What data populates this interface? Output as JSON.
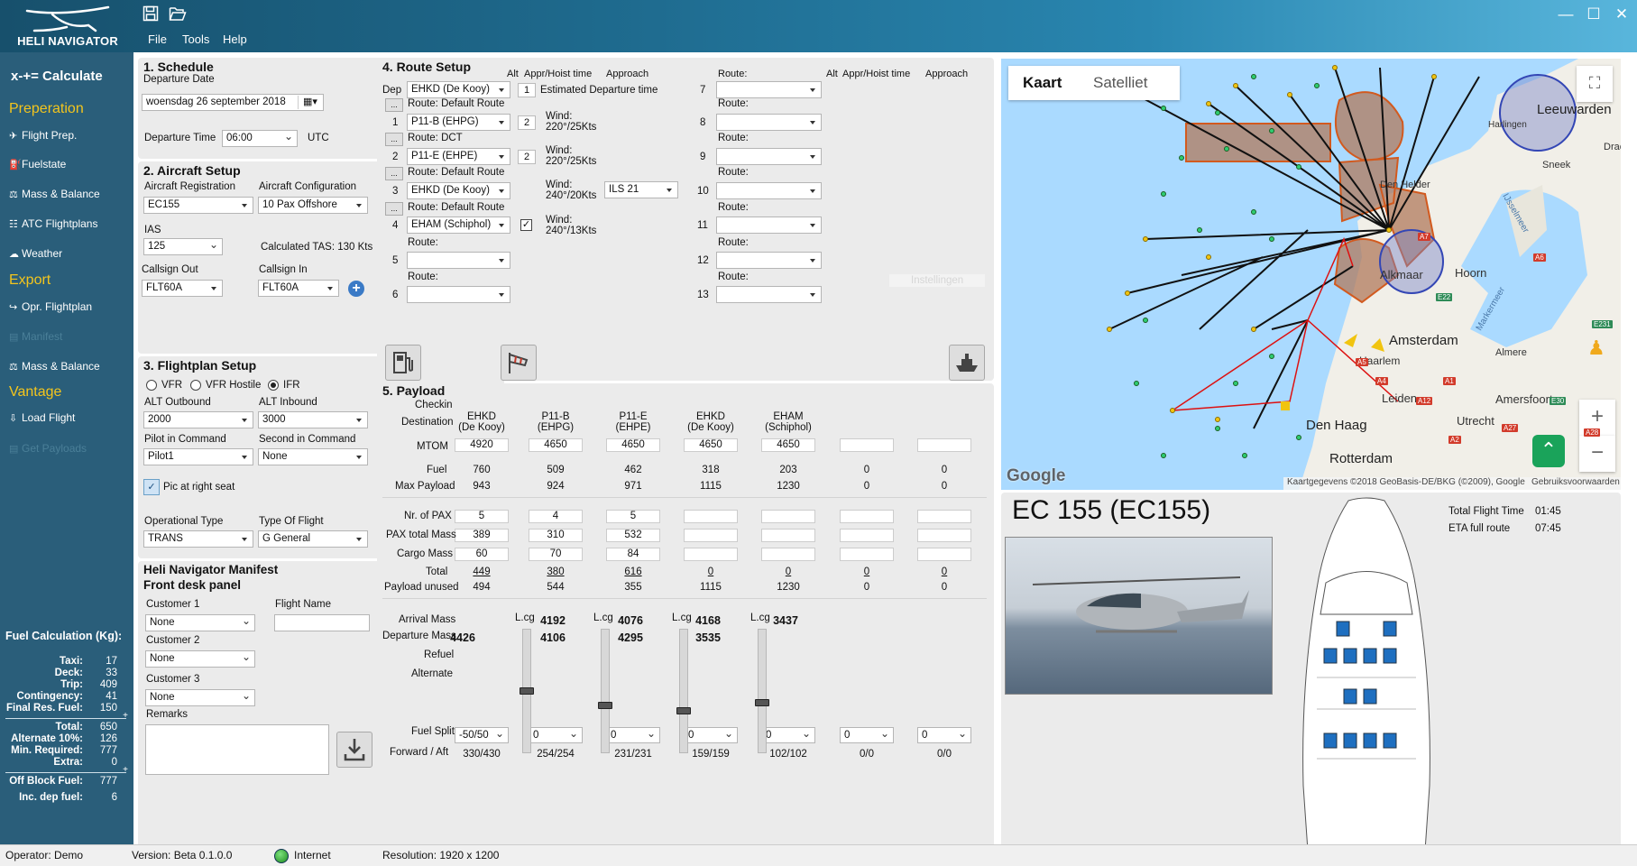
{
  "app": {
    "title": "HELI NAVIGATOR",
    "menu": [
      "File",
      "Tools",
      "Help"
    ]
  },
  "sidebar": {
    "calculate": "x-+= Calculate",
    "sections": [
      {
        "title": "Preperation",
        "items": [
          {
            "icon": "✈",
            "label": "Flight Prep.",
            "enabled": true
          },
          {
            "icon": "⛽",
            "label": "Fuelstate",
            "enabled": true
          },
          {
            "icon": "⚖",
            "label": "Mass & Balance",
            "enabled": true
          },
          {
            "icon": "☷",
            "label": "ATC Flightplans",
            "enabled": true
          },
          {
            "icon": "☁",
            "label": "Weather",
            "enabled": true
          }
        ]
      },
      {
        "title": "Export",
        "items": [
          {
            "icon": "↪",
            "label": "Opr. Flightplan",
            "enabled": true
          },
          {
            "icon": "▤",
            "label": "Manifest",
            "enabled": false
          },
          {
            "icon": "⚖",
            "label": "Mass & Balance",
            "enabled": true
          }
        ]
      },
      {
        "title": "Vantage",
        "items": [
          {
            "icon": "⇩",
            "label": "Load Flight",
            "enabled": true
          },
          {
            "icon": "▤",
            "label": "Get Payloads",
            "enabled": false
          }
        ]
      }
    ],
    "fuel": {
      "title": "Fuel Calculation (Kg):",
      "rows1": [
        [
          "Taxi:",
          "17"
        ],
        [
          "Deck:",
          "33"
        ],
        [
          "Trip:",
          "409"
        ],
        [
          "Contingency:",
          "41"
        ],
        [
          "Final Res. Fuel:",
          "150"
        ]
      ],
      "rows2": [
        [
          "Total:",
          "650"
        ],
        [
          "Alternate 10%:",
          "126"
        ],
        [
          "Min. Required:",
          "777"
        ],
        [
          "Extra:",
          "0"
        ]
      ],
      "rows3": [
        [
          "Off Block Fuel:",
          "777"
        ],
        [
          "Inc. dep fuel:",
          "6"
        ]
      ],
      "plus": "+"
    }
  },
  "schedule": {
    "title": "1. Schedule",
    "departure_date_label": "Departure Date",
    "departure_date": "woensdag 26 september 2018",
    "departure_time_label": "Departure Time",
    "departure_time": "06:00",
    "utc": "UTC"
  },
  "aircraft": {
    "title": "2. Aircraft Setup",
    "reg_label": "Aircraft Registration",
    "reg": "EC155",
    "config_label": "Aircraft Configuration",
    "config": "10 Pax Offshore",
    "ias_label": "IAS",
    "ias": "125",
    "tas": "Calculated TAS: 130 Kts",
    "callsign_out_label": "Callsign Out",
    "callsign_out": "FLT60A",
    "callsign_in_label": "Callsign In",
    "callsign_in": "FLT60A"
  },
  "flightplan": {
    "title": "3. Flightplan Setup",
    "rules": [
      "VFR",
      "VFR Hostile",
      "IFR"
    ],
    "selected_rule": 2,
    "alt_out_label": "ALT Outbound",
    "alt_out": "2000",
    "alt_in_label": "ALT Inbound",
    "alt_in": "3000",
    "pic_label": "Pilot in Command",
    "pic": "Pilot1",
    "sic_label": "Second in Command",
    "sic": "None",
    "pic_right": "Pic at right seat",
    "op_type_label": "Operational Type",
    "op_type": "TRANS",
    "flight_type_label": "Type Of Flight",
    "flight_type": "G General"
  },
  "manifest": {
    "title1": "Heli Navigator Manifest",
    "title2": "Front desk panel",
    "c1_label": "Customer 1",
    "c1": "None",
    "flight_name_label": "Flight Name",
    "c2_label": "Customer 2",
    "c2": "None",
    "c3_label": "Customer 3",
    "c3": "None",
    "remarks_label": "Remarks"
  },
  "route": {
    "title": "4. Route Setup",
    "col_alt": "Alt",
    "col_appr": "Appr/Hoist time",
    "col_approach": "Approach",
    "dep_label": "Dep",
    "dep": "EHKD (De Kooy)",
    "est_dep_label": "Estimated Departure time",
    "est_num": "1",
    "ellipsis": "...",
    "left": [
      {
        "n": "1",
        "route": "Route: Default Route",
        "val": "P11-B (EHPG)",
        "num": "2",
        "wind_label": "Wind:",
        "wind": "220°/25Kts"
      },
      {
        "n": "2",
        "route": "Route: DCT",
        "val": "P11-E (EHPE)",
        "num": "2",
        "wind_label": "Wind:",
        "wind": "220°/25Kts"
      },
      {
        "n": "3",
        "route": "Route: Default Route",
        "val": "EHKD (De Kooy)",
        "wind_label": "Wind:",
        "wind": "240°/20Kts",
        "approach": "ILS 21"
      },
      {
        "n": "4",
        "route": "Route: Default Route",
        "val": "EHAM (Schiphol)",
        "checked": true,
        "wind_label": "Wind:",
        "wind": "240°/13Kts"
      },
      {
        "n": "5",
        "route": "Route:",
        "val": ""
      },
      {
        "n": "6",
        "route": "Route:",
        "val": ""
      }
    ],
    "right_title": "Route:",
    "right": [
      "7",
      "8",
      "9",
      "10",
      "11",
      "12",
      "13"
    ],
    "right_route": "Route:",
    "watermark": "Instellingen"
  },
  "payload": {
    "title": "5. Payload",
    "checkin": "Checkin",
    "dest_label": "Destination",
    "dest": [
      [
        "EHKD",
        "(De Kooy)"
      ],
      [
        "P11-B",
        "(EHPG)"
      ],
      [
        "P11-E",
        "(EHPE)"
      ],
      [
        "EHKD",
        "(De Kooy)"
      ],
      [
        "EHAM",
        "(Schiphol)"
      ],
      [
        "",
        ""
      ],
      [
        "",
        ""
      ]
    ],
    "mtom_label": "MTOM",
    "mtom": [
      "4920",
      "4650",
      "4650",
      "4650",
      "4650",
      "",
      ""
    ],
    "fuel_label": "Fuel",
    "fuel": [
      "760",
      "509",
      "462",
      "318",
      "203",
      "0",
      "0"
    ],
    "maxp_label": "Max Payload",
    "maxp": [
      "943",
      "924",
      "971",
      "1115",
      "1230",
      "0",
      "0"
    ],
    "pax_label": "Nr. of PAX",
    "pax": [
      "5",
      "4",
      "5",
      "",
      "",
      "",
      ""
    ],
    "paxm_label": "PAX total Mass",
    "paxm": [
      "389",
      "310",
      "532",
      "",
      "",
      "",
      ""
    ],
    "cargo_label": "Cargo Mass",
    "cargo": [
      "60",
      "70",
      "84",
      "",
      "",
      "",
      ""
    ],
    "total_label": "Total",
    "total": [
      "449",
      "380",
      "616",
      "0",
      "0",
      "0",
      "0"
    ],
    "unused_label": "Payload unused",
    "unused": [
      "494",
      "544",
      "355",
      "1115",
      "1230",
      "0",
      "0"
    ],
    "arr_label": "Arrival Mass",
    "arr": [
      "",
      "4192",
      "4076",
      "4168",
      "3437"
    ],
    "dep_label": "Departure Mass",
    "depm": [
      "4426",
      "4106",
      "4295",
      "3535"
    ],
    "lcg": "L.cg",
    "refuel_label": "Refuel",
    "alternate_label": "Alternate",
    "split_label": "Fuel Split",
    "split": [
      "-50/50",
      "0",
      "0",
      "0",
      "0",
      "0",
      "0"
    ],
    "fa_label": "Forward / Aft",
    "fa": [
      "330/430",
      "254/254",
      "231/231",
      "159/159",
      "102/102",
      "0/0",
      "0/0"
    ],
    "slider_levels": [
      0.5,
      0.38,
      0.33,
      0.4
    ]
  },
  "map": {
    "tab_map": "Kaart",
    "tab_sat": "Satelliet",
    "copyright": "Kaartgegevens ©2018 GeoBasis-DE/BKG (©2009), Google",
    "terms": "Gebruiksvoorwaarden",
    "google": "Google",
    "places": [
      "Leeuwarden",
      "Harlingen",
      "Sneek",
      "Den Helder",
      "Alkmaar",
      "Hoorn",
      "Amsterdam",
      "Haarlem",
      "Leiden",
      "Den Haag",
      "Utrecht",
      "Amersfoort",
      "Rotterdam",
      "Almere",
      "Markermeer",
      "IJsselmeer",
      "Drach"
    ],
    "roads": [
      "A7",
      "E22",
      "A6",
      "A4",
      "A1",
      "A12",
      "A2",
      "E30",
      "A27",
      "A5",
      "E231",
      "A28"
    ]
  },
  "aircraft_info": {
    "name": "EC 155 (EC155)",
    "total_time_label": "Total Flight Time",
    "total_time": "01:45",
    "eta_label": "ETA full route",
    "eta": "07:45"
  },
  "status": {
    "operator": "Operator: Demo",
    "version": "Version: Beta 0.1.0.0",
    "internet": "Internet",
    "resolution": "Resolution: 1920 x 1200"
  },
  "colors": {
    "sidebar": "#2a5e7a",
    "section": "#f3c51d",
    "panel": "#ebebeb"
  }
}
